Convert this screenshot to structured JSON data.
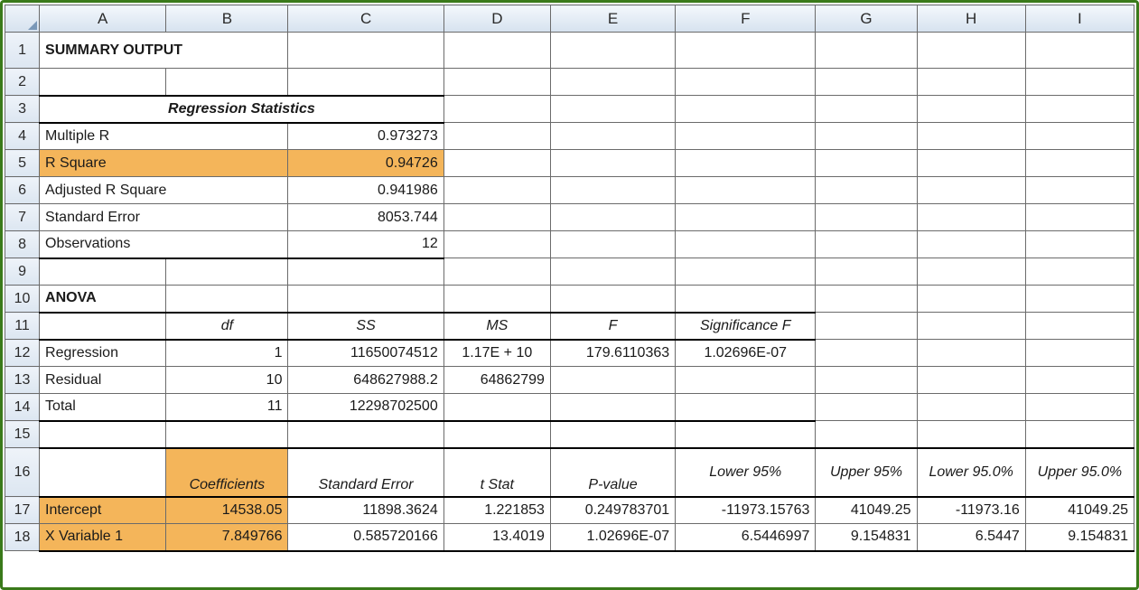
{
  "columns": [
    "A",
    "B",
    "C",
    "D",
    "E",
    "F",
    "G",
    "H",
    "I"
  ],
  "rows": [
    "1",
    "2",
    "3",
    "4",
    "5",
    "6",
    "7",
    "8",
    "9",
    "10",
    "11",
    "12",
    "13",
    "14",
    "15",
    "16",
    "17",
    "18"
  ],
  "summary_output_label": "SUMMARY OUTPUT",
  "regression_statistics_label": "Regression Statistics",
  "stats": {
    "multiple_r": {
      "label": "Multiple R",
      "value": "0.973273"
    },
    "r_square": {
      "label": "R Square",
      "value": "0.94726"
    },
    "adj_r_square": {
      "label": "Adjusted R Square",
      "value": "0.941986"
    },
    "std_error": {
      "label": "Standard Error",
      "value": "8053.744"
    },
    "observations": {
      "label": "Observations",
      "value": "12"
    }
  },
  "anova_label": "ANOVA",
  "anova_headers": {
    "df": "df",
    "ss": "SS",
    "ms": "MS",
    "f": "F",
    "sigf": "Significance F"
  },
  "anova": {
    "regression": {
      "label": "Regression",
      "df": "1",
      "ss": "11650074512",
      "ms": "1.17E + 10",
      "f": "179.6110363",
      "sigf": "1.02696E-07"
    },
    "residual": {
      "label": "Residual",
      "df": "10",
      "ss": "648627988.2",
      "ms": "64862799"
    },
    "total": {
      "label": "Total",
      "df": "11",
      "ss": "12298702500"
    }
  },
  "coef_headers": {
    "coefficients": "Coefficients",
    "std_error": "Standard Error",
    "t_stat": "t Stat",
    "p_value": "P-value",
    "lower95": "Lower 95%",
    "upper95": "Upper 95%",
    "lower95_0": "Lower 95.0%",
    "upper95_0": "Upper 95.0%"
  },
  "coef": {
    "intercept": {
      "label": "Intercept",
      "coefficients": "14538.05",
      "std_error": "11898.3624",
      "t_stat": "1.221853",
      "p_value": "0.249783701",
      "lower95": "-11973.15763",
      "upper95": "41049.25",
      "lower95_0": "-11973.16",
      "upper95_0": "41049.25"
    },
    "xvar1": {
      "label": "X Variable 1",
      "coefficients": "7.849766",
      "std_error": "0.585720166",
      "t_stat": "13.4019",
      "p_value": "1.02696E-07",
      "lower95": "6.5446997",
      "upper95": "9.154831",
      "lower95_0": "6.5447",
      "upper95_0": "9.154831"
    }
  },
  "chart_data": {
    "type": "table",
    "title": "Regression SUMMARY OUTPUT",
    "regression_statistics": {
      "Multiple R": 0.973273,
      "R Square": 0.94726,
      "Adjusted R Square": 0.941986,
      "Standard Error": 8053.744,
      "Observations": 12
    },
    "anova": [
      {
        "source": "Regression",
        "df": 1,
        "SS": 11650074512,
        "MS": 11700000000.0,
        "F": 179.6110363,
        "Significance F": 1.02696e-07
      },
      {
        "source": "Residual",
        "df": 10,
        "SS": 648627988.2,
        "MS": 64862799
      },
      {
        "source": "Total",
        "df": 11,
        "SS": 12298702500
      }
    ],
    "coefficients": [
      {
        "term": "Intercept",
        "coef": 14538.05,
        "std_err": 11898.3624,
        "t_stat": 1.221853,
        "p_value": 0.249783701,
        "lower95": -11973.15763,
        "upper95": 41049.25,
        "lower95_0": -11973.16,
        "upper95_0": 41049.25
      },
      {
        "term": "X Variable 1",
        "coef": 7.849766,
        "std_err": 0.585720166,
        "t_stat": 13.4019,
        "p_value": 1.02696e-07,
        "lower95": 6.5446997,
        "upper95": 9.154831,
        "lower95_0": 6.5447,
        "upper95_0": 9.154831
      }
    ]
  }
}
